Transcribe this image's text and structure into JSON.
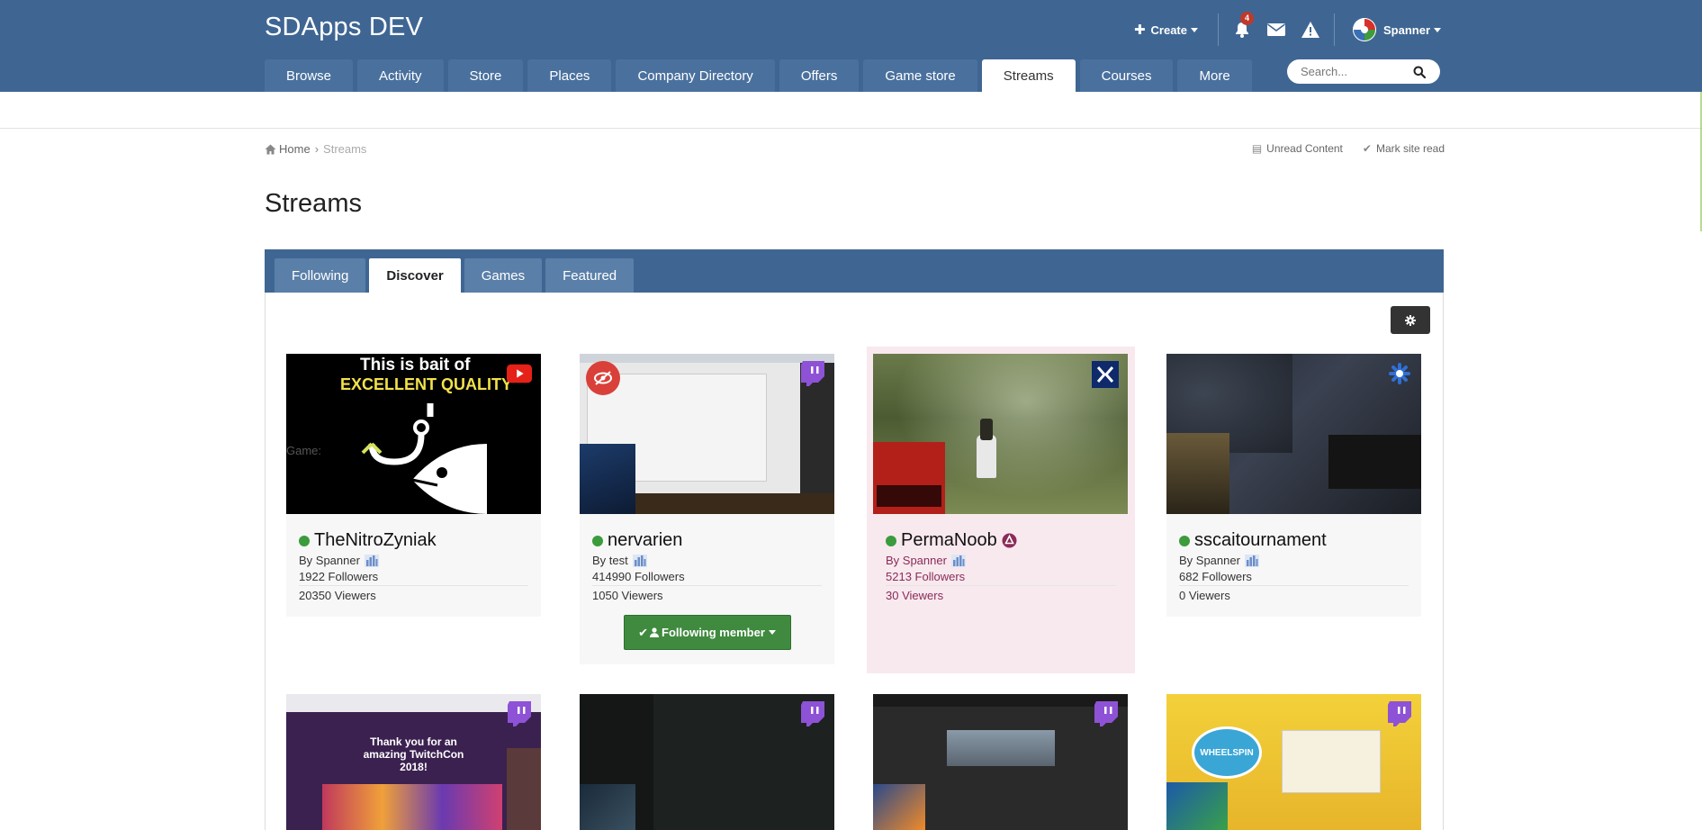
{
  "header": {
    "site_title": "SDApps DEV",
    "create_label": "Create",
    "notification_count": "4",
    "username": "Spanner",
    "search_placeholder": "Search..."
  },
  "nav": {
    "tabs": [
      {
        "label": "Browse"
      },
      {
        "label": "Activity"
      },
      {
        "label": "Store"
      },
      {
        "label": "Places"
      },
      {
        "label": "Company Directory"
      },
      {
        "label": "Offers"
      },
      {
        "label": "Game store"
      },
      {
        "label": "Streams",
        "active": true
      },
      {
        "label": "Courses"
      },
      {
        "label": "More"
      }
    ]
  },
  "breadcrumb": {
    "home": "Home",
    "current": "Streams"
  },
  "top_links": {
    "unread": "Unread Content",
    "mark_read": "Mark site read"
  },
  "page": {
    "title": "Streams"
  },
  "sub_tabs": [
    {
      "label": "Following"
    },
    {
      "label": "Discover",
      "active": true
    },
    {
      "label": "Games"
    },
    {
      "label": "Featured"
    }
  ],
  "cards": [
    {
      "name": "TheNitroZyniak",
      "by": "By Spanner",
      "followers": "1922 Followers",
      "viewers": "20350 Viewers",
      "provider": "youtube",
      "thumb_text_1": "This is bait of",
      "thumb_text_2": "EXCELLENT QUALITY",
      "game_label": "Game:"
    },
    {
      "name": "nervarien",
      "by": "By test",
      "followers": "414990 Followers",
      "viewers": "1050 Viewers",
      "provider": "twitch",
      "follow_label": "Following member"
    },
    {
      "name": "PermaNoob",
      "by": "By Spanner",
      "followers": "5213 Followers",
      "viewers": "30 Viewers",
      "provider": "mixer",
      "highlight": true
    },
    {
      "name": "sscaitournament",
      "by": "By Spanner",
      "followers": "682 Followers",
      "viewers": "0 Viewers",
      "provider": "other"
    }
  ],
  "bottom_cards": [
    {
      "thumb_text_1": "Thank you for an",
      "thumb_text_2": "amazing TwitchCon",
      "thumb_text_3": "2018!",
      "provider": "twitch"
    },
    {
      "provider": "twitch"
    },
    {
      "provider": "twitch"
    },
    {
      "thumb_text_1": "WHEELSPIN",
      "provider": "twitch"
    }
  ],
  "colors": {
    "header_bg": "#3f6693",
    "live_dot": "#3c9b3c",
    "follow_btn": "#3f8a3f",
    "twitch": "#8e52d6",
    "youtube": "#e62117"
  }
}
